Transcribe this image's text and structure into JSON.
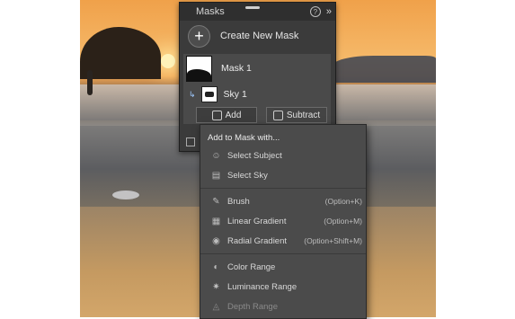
{
  "panel": {
    "title": "Masks",
    "help": "?",
    "collapse": "»",
    "create_label": "Create New Mask",
    "masks": [
      {
        "name": "Mask 1",
        "sub": "Sky 1"
      }
    ],
    "add_label": "Add",
    "subtract_label": "Subtract"
  },
  "menu": {
    "title": "Add to Mask with...",
    "groups": [
      [
        {
          "label": "Select Subject",
          "icon": "person-icon",
          "shortcut": ""
        },
        {
          "label": "Select Sky",
          "icon": "sky-icon",
          "shortcut": ""
        }
      ],
      [
        {
          "label": "Brush",
          "icon": "brush-icon",
          "shortcut": "(Option+K)"
        },
        {
          "label": "Linear Gradient",
          "icon": "linear-gradient-icon",
          "shortcut": "(Option+M)"
        },
        {
          "label": "Radial Gradient",
          "icon": "radial-gradient-icon",
          "shortcut": "(Option+Shift+M)"
        }
      ],
      [
        {
          "label": "Color Range",
          "icon": "color-range-icon",
          "shortcut": ""
        },
        {
          "label": "Luminance Range",
          "icon": "luminance-range-icon",
          "shortcut": ""
        },
        {
          "label": "Depth Range",
          "icon": "depth-range-icon",
          "shortcut": "",
          "disabled": true
        }
      ]
    ]
  }
}
